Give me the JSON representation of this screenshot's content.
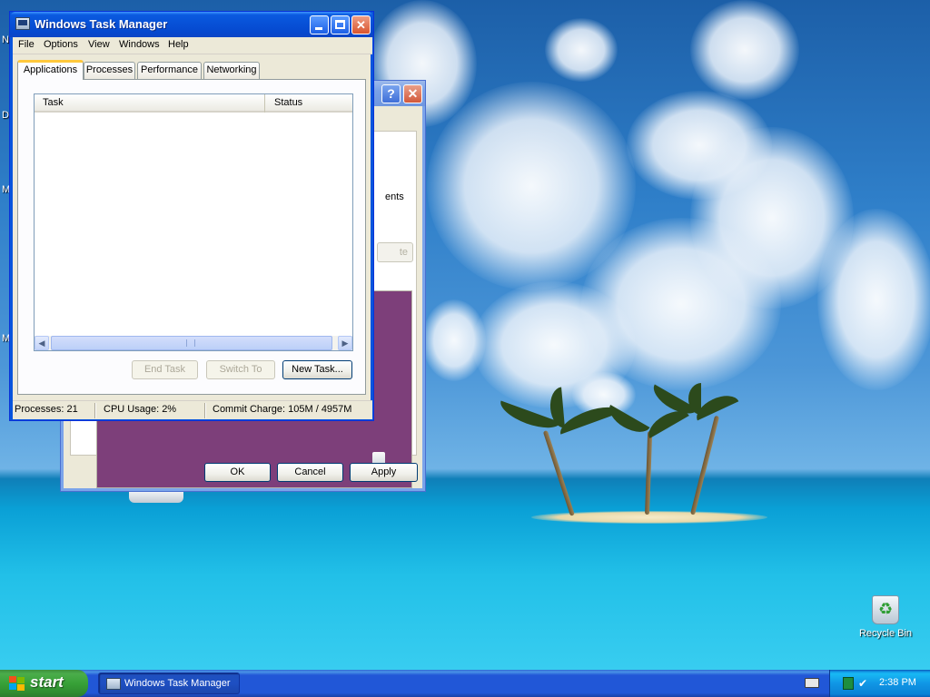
{
  "window": {
    "title": "Windows Task Manager"
  },
  "menu": [
    "File",
    "Options",
    "View",
    "Windows",
    "Help"
  ],
  "tabs": [
    "Applications",
    "Processes",
    "Performance",
    "Networking"
  ],
  "active_tab": "Applications",
  "task_list": {
    "columns": [
      "Task",
      "Status"
    ],
    "rows": []
  },
  "buttons": {
    "end_task": "End Task",
    "switch_to": "Switch To",
    "new_task": "New Task..."
  },
  "status_bar": {
    "processes": "Processes: 21",
    "cpu_usage": "CPU Usage: 2%",
    "commit_charge": "Commit Charge: 105M / 4957M"
  },
  "background_dialog": {
    "partial_text": "ents",
    "partial_button": "te",
    "ok_label": "OK",
    "cancel_label": "Cancel",
    "apply_label": "Apply",
    "help_glyph": "?",
    "close_glyph": "✕",
    "preview_color": "#7d3f7a"
  },
  "desktop": {
    "recycle_bin_label": "Recycle Bin",
    "edge_letters": [
      "N",
      "D",
      "M",
      "M"
    ]
  },
  "taskbar": {
    "start_label": "start",
    "task_button_label": "Windows Task Manager",
    "clock": "2:38 PM"
  },
  "colors": {
    "titlebar_blue": "#0750d6",
    "start_green": "#37a137",
    "tab_highlight": "#ffc83c"
  },
  "icons": {
    "title": "taskmgr-icon",
    "recycle": "recycle-bin-icon",
    "keyboard": "keyboard-icon"
  }
}
